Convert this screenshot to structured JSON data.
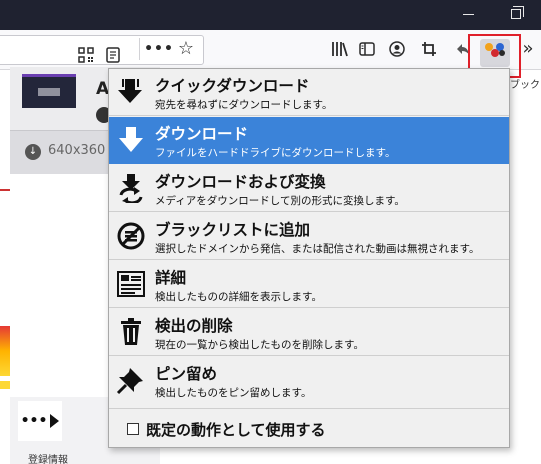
{
  "browser": {
    "icons": [
      "qr-code-icon",
      "reader-view-icon",
      "more-icon",
      "bookmark-star-icon",
      "library-icon",
      "sidebar-icon",
      "account-icon",
      "screenshot-icon",
      "back-icon",
      "video-downloadhelper-icon",
      "overflow-icon"
    ],
    "tooltip_fragment": "ブックマ"
  },
  "panel": {
    "title_fragment": "A",
    "resolution": "640x360",
    "footer_text": "登録情報"
  },
  "menu": {
    "items": [
      {
        "title": "クイックダウンロード",
        "desc": "宛先を尋ねずにダウンロードします。",
        "icon": "quick-download-icon"
      },
      {
        "title": "ダウンロード",
        "desc": "ファイルをハードドライブにダウンロードします。",
        "icon": "download-icon"
      },
      {
        "title": "ダウンロードおよび変換",
        "desc": "メディアをダウンロードして別の形式に変換します。",
        "icon": "download-convert-icon"
      },
      {
        "title": "ブラックリストに追加",
        "desc": "選択したドメインから発信、または配信された動画は無視されます。",
        "icon": "blacklist-icon"
      },
      {
        "title": "詳細",
        "desc": "検出したものの詳細を表示します。",
        "icon": "details-icon"
      },
      {
        "title": "検出の削除",
        "desc": "現在の一覧から検出したものを削除します。",
        "icon": "trash-icon"
      },
      {
        "title": "ピン留め",
        "desc": "検出したものをピン留めします。",
        "icon": "pin-icon"
      }
    ],
    "default_action_label": "既定の動作として使用する"
  },
  "colors": {
    "highlight": "#3b83d9",
    "title_bar": "#1f2230",
    "focus_outline": "#e0202a"
  }
}
